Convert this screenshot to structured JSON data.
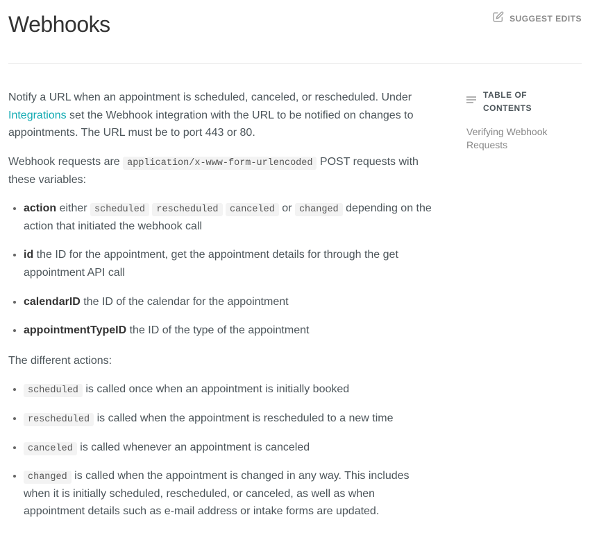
{
  "header": {
    "title": "Webhooks",
    "suggest_edits": "SUGGEST EDITS"
  },
  "intro": {
    "p1_a": "Notify a URL when an appointment is scheduled, canceled, or rescheduled. Under ",
    "integrations_link": "Integrations",
    "p1_b": " set the Webhook integration with the URL to be notified on changes to appointments. The URL must be to port 443 or 80.",
    "p2_a": "Webhook requests are ",
    "p2_code": "application/x-www-form-urlencoded",
    "p2_b": " POST requests with these variables:"
  },
  "variables": [
    {
      "name": "action",
      "pre": " either ",
      "codes": [
        "scheduled",
        "rescheduled",
        "canceled"
      ],
      "mid": " or ",
      "last_code": "changed",
      "post": " depending on the action that initiated the webhook call"
    },
    {
      "name": "id",
      "post": " the ID for the appointment, get the appointment details for through the get appointment API call"
    },
    {
      "name": "calendarID",
      "post": " the ID of the calendar for the appointment"
    },
    {
      "name": "appointmentTypeID",
      "post": " the ID of the type of the appointment"
    }
  ],
  "actions_intro": "The different actions:",
  "actions": [
    {
      "code": "scheduled",
      "text": " is called once when an appointment is initially booked"
    },
    {
      "code": "rescheduled",
      "text": " is called when the appointment is rescheduled to a new time"
    },
    {
      "code": "canceled",
      "text": " is called whenever an appointment is canceled"
    },
    {
      "code": "changed",
      "text": " is called when the appointment is changed in any way. This includes when it is initially scheduled, rescheduled, or canceled, as well as when appointment details such as e-mail address or intake forms are updated."
    }
  ],
  "toc": {
    "title": "TABLE OF CONTENTS",
    "items": [
      "Verifying Webhook Requests"
    ]
  }
}
